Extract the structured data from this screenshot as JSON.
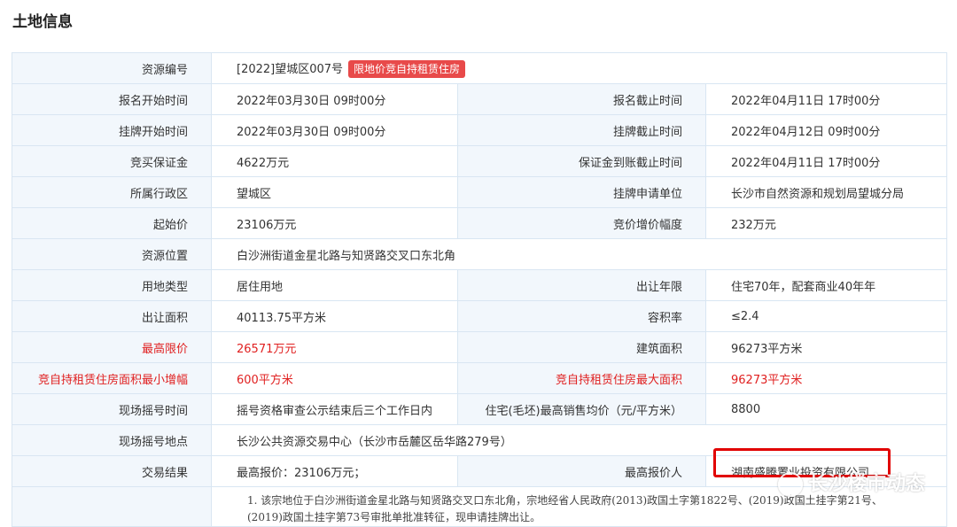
{
  "page_title": "土地信息",
  "rows": [
    {
      "l1": "资源编号",
      "v1": "[2022]望城区007号",
      "tag": "限地价竞自持租赁住房"
    },
    {
      "l1": "报名开始时间",
      "v1": "2022年03月30日 09时00分",
      "l2": "报名截止时间",
      "v2": "2022年04月11日 17时00分"
    },
    {
      "l1": "挂牌开始时间",
      "v1": "2022年03月30日 09时00分",
      "l2": "挂牌截止时间",
      "v2": "2022年04月12日 09时00分"
    },
    {
      "l1": "竞买保证金",
      "v1": "4622万元",
      "l2": "保证金到账截止时间",
      "v2": "2022年04月11日 17时00分"
    },
    {
      "l1": "所属行政区",
      "v1": "望城区",
      "l2": "挂牌申请单位",
      "v2": "长沙市自然资源和规划局望城分局"
    },
    {
      "l1": "起始价",
      "v1": "23106万元",
      "l2": "竞价增价幅度",
      "v2": "232万元"
    },
    {
      "l1": "资源位置",
      "v1": "白沙洲街道金星北路与知贤路交叉口东北角"
    },
    {
      "l1": "用地类型",
      "v1": "居住用地",
      "l2": "出让年限",
      "v2": "住宅70年，配套商业40年年"
    },
    {
      "l1": "出让面积",
      "v1": "40113.75平方米",
      "l2": "容积率",
      "v2": "≤2.4"
    },
    {
      "l1": "最高限价",
      "v1": "26571万元",
      "l2": "建筑面积",
      "v2": "96273平方米"
    },
    {
      "l1": "竞自持租赁住房面积最小增幅",
      "v1": "600平方米",
      "l2": "竞自持租赁住房最大面积",
      "v2": "96273平方米"
    },
    {
      "l1": "现场摇号时间",
      "v1": "摇号资格审查公示结束后三个工作日内",
      "l2": "住宅(毛坯)最高销售均价（元/平方米）",
      "v2": "8800"
    },
    {
      "l1": "现场摇号地点",
      "v1": "长沙公共资源交易中心（长沙市岳麓区岳华路279号）"
    },
    {
      "l1": "交易结果",
      "v1": "最高报价：23106万元；",
      "l2": "最高报价人",
      "v2": "湖南盛腾置业投资有限公司"
    }
  ],
  "notes": "1. 该宗地位于白沙洲街道金星北路与知贤路交叉口东北角，宗地经省人民政府(2013)政国土字第1822号、(2019)政国土挂字第21号、(2019)政国土挂字第73号审批单批准转征，现申请挂牌出让。",
  "watermark": "长沙楼市动态",
  "colors": {
    "accent_red": "#e02020",
    "label_bg": "#f2f7fc",
    "border": "#d9e6f2",
    "tag_bg": "#e84a4a"
  }
}
